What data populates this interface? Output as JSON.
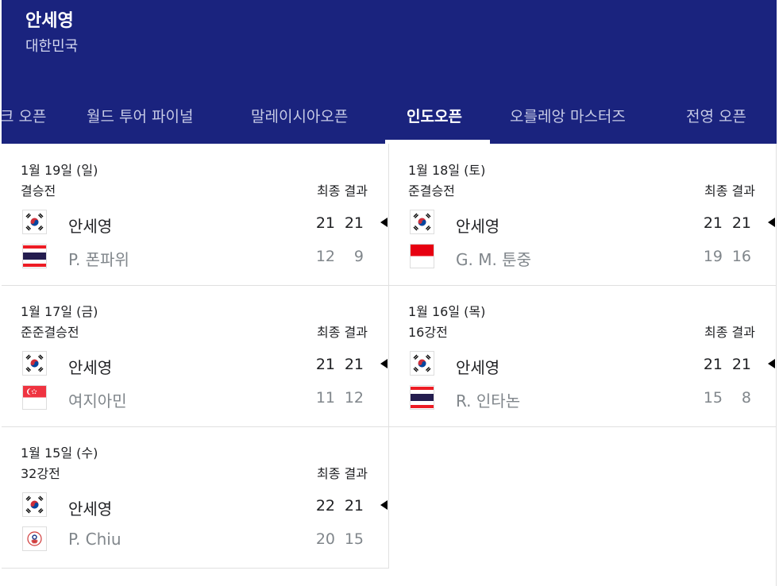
{
  "header": {
    "player_name": "안세영",
    "country": "대한민국",
    "bg_color": "#1a237e"
  },
  "tabs": [
    {
      "label": "크 오픈"
    },
    {
      "label": "월드 투어 파이널"
    },
    {
      "label": "말레이시아오픈"
    },
    {
      "label": "인도오픈",
      "active": true
    },
    {
      "label": "오를레앙 마스터즈"
    },
    {
      "label": "전영 오픈"
    }
  ],
  "matches": [
    {
      "date": "1월 19일 (일)",
      "round": "결승전",
      "status": "최종 결과",
      "p1": {
        "name": "안세영",
        "flag": "korea-flag-icon",
        "scores": [
          "21",
          "21"
        ],
        "winner": true
      },
      "p2": {
        "name": "P. 폰파위",
        "flag": "thailand-flag-icon",
        "scores": [
          "12",
          "9"
        ]
      }
    },
    {
      "date": "1월 18일 (토)",
      "round": "준결승전",
      "status": "최종 결과",
      "p1": {
        "name": "안세영",
        "flag": "korea-flag-icon",
        "scores": [
          "21",
          "21"
        ],
        "winner": true
      },
      "p2": {
        "name": "G. M. 툰중",
        "flag": "indonesia-flag-icon",
        "scores": [
          "19",
          "16"
        ]
      }
    },
    {
      "date": "1월 17일 (금)",
      "round": "준준결승전",
      "status": "최종 결과",
      "p1": {
        "name": "안세영",
        "flag": "korea-flag-icon",
        "scores": [
          "21",
          "21"
        ],
        "winner": true
      },
      "p2": {
        "name": "여지아민",
        "flag": "singapore-flag-icon",
        "scores": [
          "11",
          "12"
        ]
      }
    },
    {
      "date": "1월 16일 (목)",
      "round": "16강전",
      "status": "최종 결과",
      "p1": {
        "name": "안세영",
        "flag": "korea-flag-icon",
        "scores": [
          "21",
          "21"
        ],
        "winner": true
      },
      "p2": {
        "name": "R. 인타논",
        "flag": "thailand-flag-icon",
        "scores": [
          "15",
          "8"
        ]
      }
    },
    {
      "date": "1월 15일 (수)",
      "round": "32강전",
      "status": "최종 결과",
      "p1": {
        "name": "안세영",
        "flag": "korea-flag-icon",
        "scores": [
          "22",
          "21"
        ],
        "winner": true
      },
      "p2": {
        "name": "P. Chiu",
        "flag": "chinese-taipei-flag-icon",
        "scores": [
          "20",
          "15"
        ]
      }
    }
  ]
}
